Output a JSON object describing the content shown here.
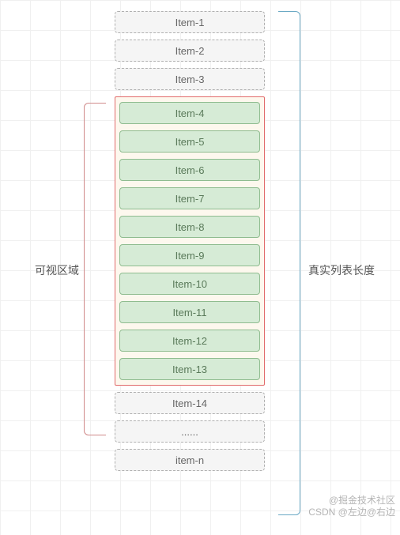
{
  "itemsBefore": [
    {
      "label": "Item-1"
    },
    {
      "label": "Item-2"
    },
    {
      "label": "Item-3"
    }
  ],
  "viewportItems": [
    {
      "label": "Item-4"
    },
    {
      "label": "Item-5"
    },
    {
      "label": "Item-6"
    },
    {
      "label": "Item-7"
    },
    {
      "label": "Item-8"
    },
    {
      "label": "Item-9"
    },
    {
      "label": "Item-10"
    },
    {
      "label": "Item-11"
    },
    {
      "label": "Item-12"
    },
    {
      "label": "Item-13"
    }
  ],
  "itemsAfter": [
    {
      "label": "Item-14"
    },
    {
      "label": "......"
    },
    {
      "label": "item-n"
    }
  ],
  "labels": {
    "leftBracket": "可视区域",
    "rightBracket": "真实列表长度"
  },
  "watermark": {
    "line1": "@掘金技术社区",
    "line2": "CSDN @左边@右边"
  }
}
